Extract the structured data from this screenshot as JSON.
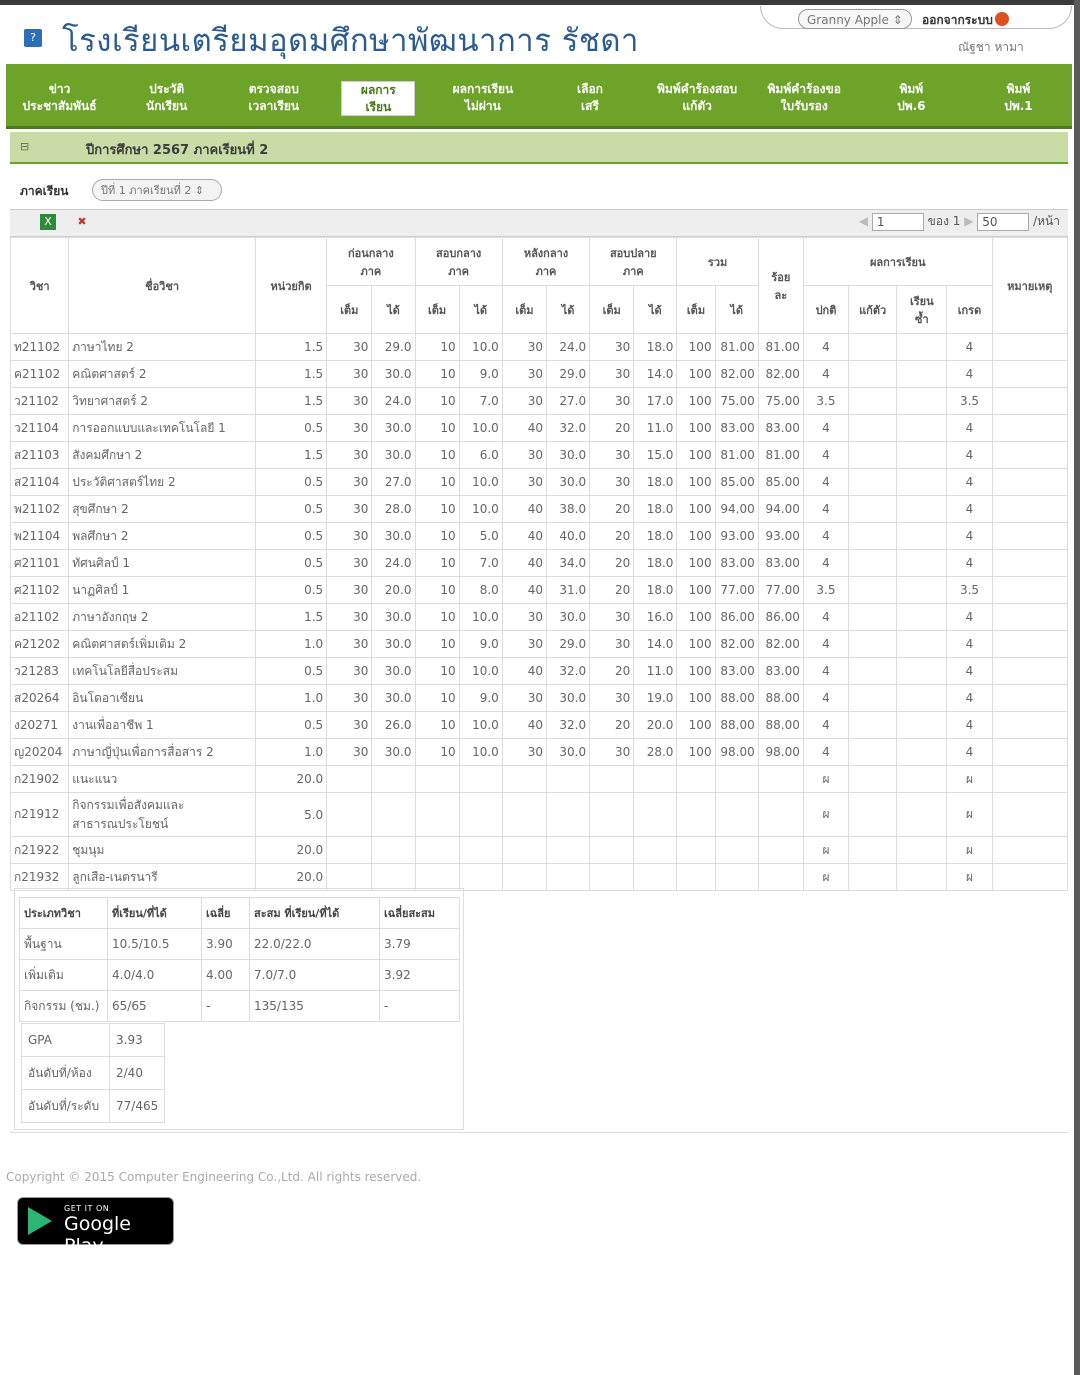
{
  "header": {
    "school_name": "โรงเรียนเตรียมอุดมศึกษาพัฒนาการ รัชดา",
    "user_select": "Granny Apple",
    "logout_label": "ออกจากระบบ",
    "username": "ณัฐชา หามา"
  },
  "nav": {
    "items": [
      {
        "line1": "ข่าว",
        "line2": "ประชาสัมพันธ์"
      },
      {
        "line1": "ประวัติ",
        "line2": "นักเรียน"
      },
      {
        "line1": "ตรวจสอบ",
        "line2": "เวลาเรียน"
      },
      {
        "line1": "ผลการ",
        "line2": "เรียน"
      },
      {
        "line1": "ผลการเรียน",
        "line2": "ไม่ผ่าน"
      },
      {
        "line1": "เลือก",
        "line2": "เสรี"
      },
      {
        "line1": "พิมพ์คำร้องสอบ",
        "line2": "แก้ตัว"
      },
      {
        "line1": "พิมพ์คำร้องขอ",
        "line2": "ใบรับรอง"
      },
      {
        "line1": "พิมพ์",
        "line2": "ปพ.6"
      },
      {
        "line1": "พิมพ์",
        "line2": "ปพ.1"
      }
    ]
  },
  "year_bar": {
    "text": "ปีการศึกษา 2567 ภาคเรียนที่ 2"
  },
  "term": {
    "label": "ภาคเรียน",
    "selected": "ปีที่ 1 ภาคเรียนที่ 2"
  },
  "pager": {
    "page": "1",
    "of_label": "ของ 1",
    "per_page": "50",
    "per_page_unit": "/หน้า"
  },
  "table": {
    "headers": {
      "code": "วิชา",
      "name": "ชื่อวิชา",
      "credit": "หน่วยกิต",
      "pre_mid_1": "ก่อนกลาง",
      "pre_mid_2": "ภาค",
      "mid_1": "สอบกลาง",
      "mid_2": "ภาค",
      "post_mid_1": "หลังกลาง",
      "post_mid_2": "ภาค",
      "final_1": "สอบปลาย",
      "final_2": "ภาค",
      "total": "รวม",
      "percent_1": "ร้อย",
      "percent_2": "ละ",
      "result": "ผลการเรียน",
      "remark": "หมายเหตุ",
      "full": "เต็ม",
      "got": "ได้",
      "normal": "ปกติ",
      "retake": "แก้ตัว",
      "repeat_1": "เรียน",
      "repeat_2": "ซ้ำ",
      "grade": "เกรด"
    },
    "rows": [
      [
        "ท21102",
        "ภาษาไทย 2",
        "1.5",
        "30",
        "29.0",
        "10",
        "10.0",
        "30",
        "24.0",
        "30",
        "18.0",
        "100",
        "81.00",
        "81.00",
        "4",
        "",
        "",
        "4",
        ""
      ],
      [
        "ค21102",
        "คณิตศาสตร์ 2",
        "1.5",
        "30",
        "30.0",
        "10",
        "9.0",
        "30",
        "29.0",
        "30",
        "14.0",
        "100",
        "82.00",
        "82.00",
        "4",
        "",
        "",
        "4",
        ""
      ],
      [
        "ว21102",
        "วิทยาศาสตร์ 2",
        "1.5",
        "30",
        "24.0",
        "10",
        "7.0",
        "30",
        "27.0",
        "30",
        "17.0",
        "100",
        "75.00",
        "75.00",
        "3.5",
        "",
        "",
        "3.5",
        ""
      ],
      [
        "ว21104",
        "การออกแบบและเทคโนโลยี 1",
        "0.5",
        "30",
        "30.0",
        "10",
        "10.0",
        "40",
        "32.0",
        "20",
        "11.0",
        "100",
        "83.00",
        "83.00",
        "4",
        "",
        "",
        "4",
        ""
      ],
      [
        "ส21103",
        "สังคมศึกษา 2",
        "1.5",
        "30",
        "30.0",
        "10",
        "6.0",
        "30",
        "30.0",
        "30",
        "15.0",
        "100",
        "81.00",
        "81.00",
        "4",
        "",
        "",
        "4",
        ""
      ],
      [
        "ส21104",
        "ประวัติศาสตร์ไทย 2",
        "0.5",
        "30",
        "27.0",
        "10",
        "10.0",
        "30",
        "30.0",
        "30",
        "18.0",
        "100",
        "85.00",
        "85.00",
        "4",
        "",
        "",
        "4",
        ""
      ],
      [
        "พ21102",
        "สุขศึกษา 2",
        "0.5",
        "30",
        "28.0",
        "10",
        "10.0",
        "40",
        "38.0",
        "20",
        "18.0",
        "100",
        "94.00",
        "94.00",
        "4",
        "",
        "",
        "4",
        ""
      ],
      [
        "พ21104",
        "พลศึกษา 2",
        "0.5",
        "30",
        "30.0",
        "10",
        "5.0",
        "40",
        "40.0",
        "20",
        "18.0",
        "100",
        "93.00",
        "93.00",
        "4",
        "",
        "",
        "4",
        ""
      ],
      [
        "ศ21101",
        "ทัศนศิลป์ 1",
        "0.5",
        "30",
        "24.0",
        "10",
        "7.0",
        "40",
        "34.0",
        "20",
        "18.0",
        "100",
        "83.00",
        "83.00",
        "4",
        "",
        "",
        "4",
        ""
      ],
      [
        "ศ21102",
        "นาฏศิลป์ 1",
        "0.5",
        "30",
        "20.0",
        "10",
        "8.0",
        "40",
        "31.0",
        "20",
        "18.0",
        "100",
        "77.00",
        "77.00",
        "3.5",
        "",
        "",
        "3.5",
        ""
      ],
      [
        "อ21102",
        "ภาษาอังกฤษ 2",
        "1.5",
        "30",
        "30.0",
        "10",
        "10.0",
        "30",
        "30.0",
        "30",
        "16.0",
        "100",
        "86.00",
        "86.00",
        "4",
        "",
        "",
        "4",
        ""
      ],
      [
        "ค21202",
        "คณิตศาสตร์เพิ่มเติม 2",
        "1.0",
        "30",
        "30.0",
        "10",
        "9.0",
        "30",
        "29.0",
        "30",
        "14.0",
        "100",
        "82.00",
        "82.00",
        "4",
        "",
        "",
        "4",
        ""
      ],
      [
        "ว21283",
        "เทคโนโลยีสื่อประสม",
        "0.5",
        "30",
        "30.0",
        "10",
        "10.0",
        "40",
        "32.0",
        "20",
        "11.0",
        "100",
        "83.00",
        "83.00",
        "4",
        "",
        "",
        "4",
        ""
      ],
      [
        "ส20264",
        "อินโดอาเซียน",
        "1.0",
        "30",
        "30.0",
        "10",
        "9.0",
        "30",
        "30.0",
        "30",
        "19.0",
        "100",
        "88.00",
        "88.00",
        "4",
        "",
        "",
        "4",
        ""
      ],
      [
        "ง20271",
        "งานเพื่ออาชีพ 1",
        "0.5",
        "30",
        "26.0",
        "10",
        "10.0",
        "40",
        "32.0",
        "20",
        "20.0",
        "100",
        "88.00",
        "88.00",
        "4",
        "",
        "",
        "4",
        ""
      ],
      [
        "ญ20204",
        "ภาษาญี่ปุ่นเพื่อการสื่อสาร 2",
        "1.0",
        "30",
        "30.0",
        "10",
        "10.0",
        "30",
        "30.0",
        "30",
        "28.0",
        "100",
        "98.00",
        "98.00",
        "4",
        "",
        "",
        "4",
        ""
      ],
      [
        "ก21902",
        "แนะแนว",
        "20.0",
        "",
        "",
        "",
        "",
        "",
        "",
        "",
        "",
        "",
        "",
        "",
        "ผ",
        "",
        "",
        "ผ",
        ""
      ],
      [
        "ก21912",
        "กิจกรรมเพื่อสังคมและสาธารณประโยชน์",
        "5.0",
        "",
        "",
        "",
        "",
        "",
        "",
        "",
        "",
        "",
        "",
        "",
        "ผ",
        "",
        "",
        "ผ",
        ""
      ],
      [
        "ก21922",
        "ชุมนุม",
        "20.0",
        "",
        "",
        "",
        "",
        "",
        "",
        "",
        "",
        "",
        "",
        "",
        "ผ",
        "",
        "",
        "ผ",
        ""
      ],
      [
        "ก21932",
        "ลูกเสือ-เนตรนารี",
        "20.0",
        "",
        "",
        "",
        "",
        "",
        "",
        "",
        "",
        "",
        "",
        "",
        "ผ",
        "",
        "",
        "ผ",
        ""
      ]
    ]
  },
  "summary": {
    "headers": [
      "ประเภทวิชา",
      "ที่เรียน/ที่ได้",
      "เฉลี่ย",
      "สะสม ที่เรียน/ที่ได้",
      "เฉลี่ยสะสม"
    ],
    "rows": [
      [
        "พื้นฐาน",
        "10.5/10.5",
        "3.90",
        "22.0/22.0",
        "3.79"
      ],
      [
        "เพิ่มเติม",
        "4.0/4.0",
        "4.00",
        "7.0/7.0",
        "3.92"
      ],
      [
        "กิจกรรม (ชม.)",
        "65/65",
        "-",
        "135/135",
        "-"
      ]
    ],
    "gpa_rows": [
      [
        "GPA",
        "3.93"
      ],
      [
        "อันดับที่/ห้อง",
        "2/40"
      ],
      [
        "อันดับที่/ระดับ",
        "77/465"
      ]
    ]
  },
  "footer": {
    "copyright": "Copyright © 2015 Computer Engineering Co.,Ltd. All rights reserved.",
    "gplay_small": "GET IT ON",
    "gplay_big": "Google Play"
  }
}
